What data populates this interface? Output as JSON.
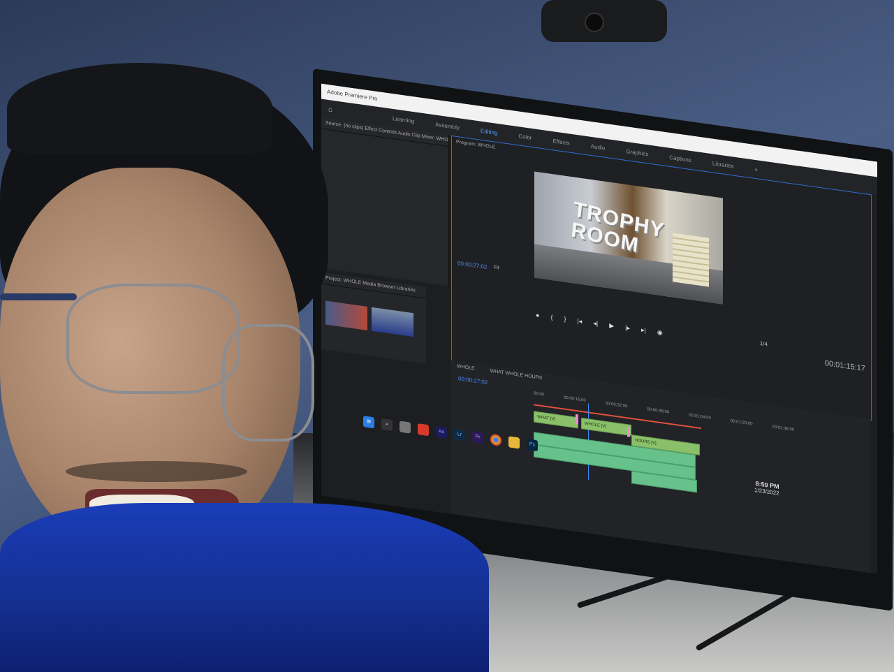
{
  "premiere": {
    "menu": [
      "Learning",
      "Assembly",
      "Editing",
      "Color",
      "Effects",
      "Audio",
      "Graphics",
      "Captions",
      "Libraries"
    ],
    "active_menu": "Editing",
    "source_panel_tabs": "Source: (no clips)   Effect Controls   Audio Clip Mixer: WHOLE",
    "program_title": "Program: WHOLE",
    "program_timecode": "00:00:27:02",
    "fit_label": "Fit",
    "ratio": "1/4",
    "duration": "00:01:15:17",
    "video_overlay_text_1": "TROPHY",
    "video_overlay_text_2": "ROOM",
    "project_tab": "Project: WHOLE   Media Browser   Libraries",
    "timeline_tab": "WHOLE",
    "timeline_sequences": "WHAT     WHOLE     HOURS",
    "timeline_timecode": "00:00:27:02",
    "ruler": [
      "00:00",
      "00:00:16:00",
      "00:00:32:00",
      "00:00:48:00",
      "00:01:04:00",
      "00:01:20:00",
      "00:01:36:00"
    ],
    "clip_labels": [
      "WHAT [V]",
      "WHOLE [V]",
      "HOURS [V]"
    ]
  },
  "taskbar": {
    "icons": [
      "Ae",
      "Lr",
      "Pr",
      "Ps"
    ],
    "time": "8:59 PM",
    "date": "1/23/2022"
  }
}
